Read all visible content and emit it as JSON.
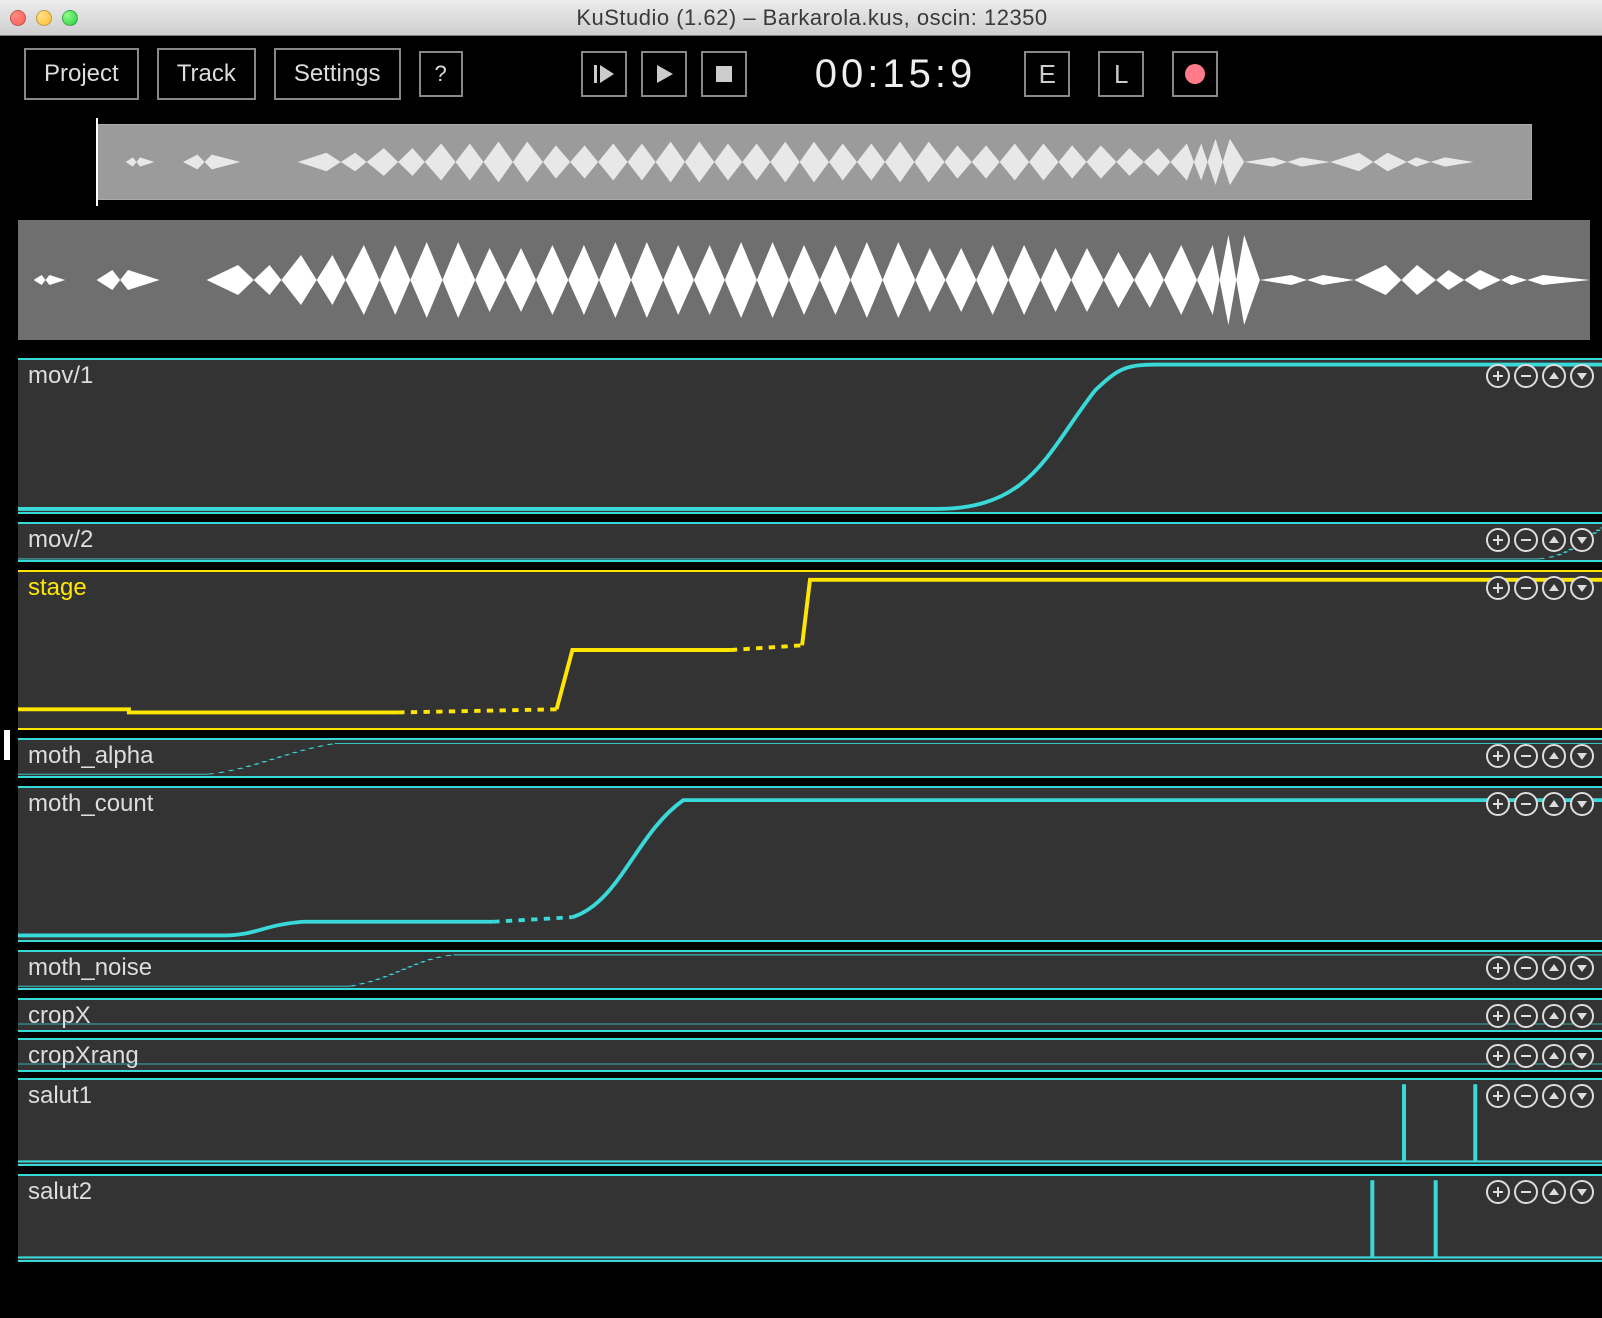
{
  "window": {
    "title": "KuStudio (1.62) – Barkarola.kus, oscin: 12350"
  },
  "toolbar": {
    "project": "Project",
    "track": "Track",
    "settings": "Settings",
    "help": "?",
    "time": "00:15:9",
    "toggle_e": "E",
    "toggle_l": "L"
  },
  "tracks": [
    {
      "name": "mov/1",
      "color": "cyan",
      "height": "h-lg"
    },
    {
      "name": "mov/2",
      "color": "cyan",
      "height": "h-md"
    },
    {
      "name": "stage",
      "color": "yellow",
      "height": "h-stage"
    },
    {
      "name": "moth_alpha",
      "color": "cyan",
      "height": "h-md"
    },
    {
      "name": "moth_count",
      "color": "cyan",
      "height": "h-count"
    },
    {
      "name": "moth_noise",
      "color": "cyan",
      "height": "h-noise"
    },
    {
      "name": "cropX",
      "color": "cyan",
      "height": "h-thin"
    },
    {
      "name": "cropXrang",
      "color": "cyan",
      "height": "h-thin"
    },
    {
      "name": "salut1",
      "color": "cyan",
      "height": "h-salut"
    },
    {
      "name": "salut2",
      "color": "cyan",
      "height": "h-salut"
    }
  ],
  "track_controls": [
    "plus",
    "minus",
    "up",
    "down"
  ]
}
